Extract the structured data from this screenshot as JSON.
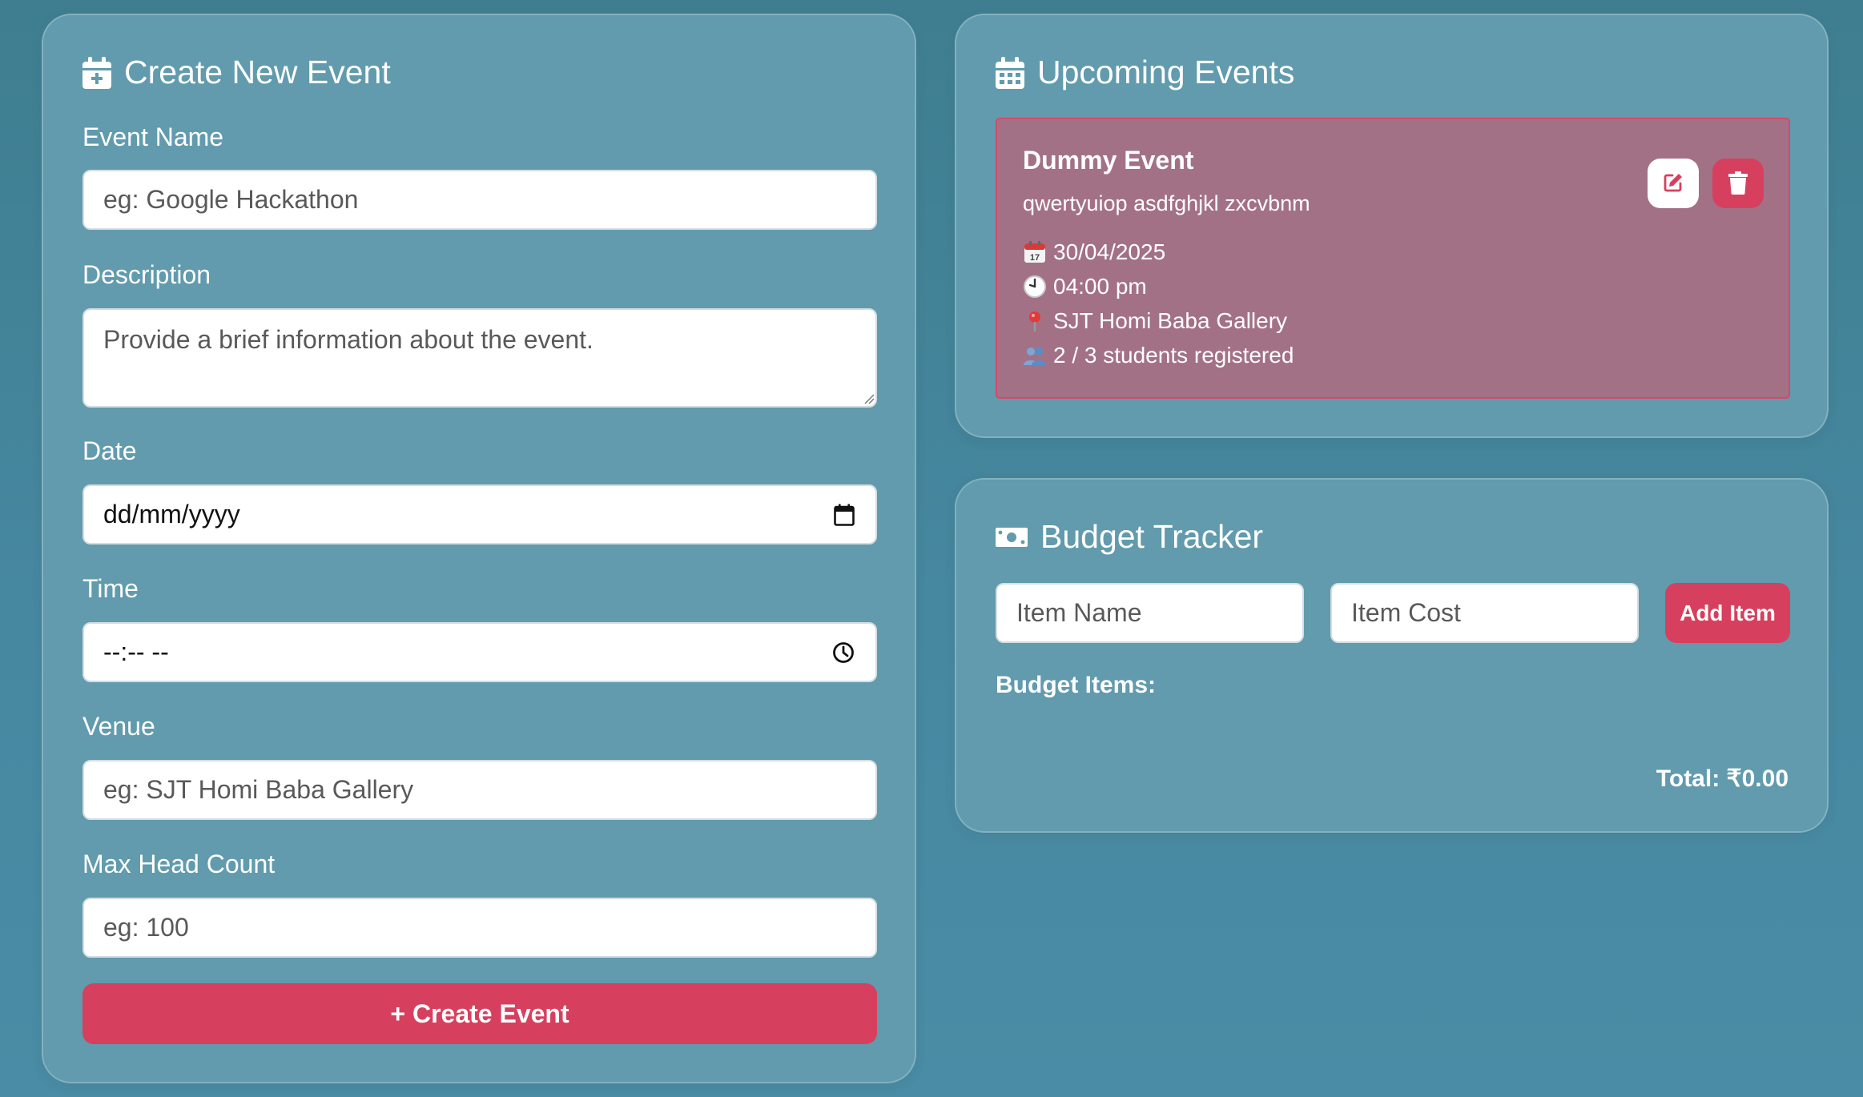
{
  "colors": {
    "accent": "#d6405e",
    "card_background": "#619bad",
    "event_background": "#a37186"
  },
  "create_event": {
    "title": "Create New Event",
    "icon": "calendar-plus-icon",
    "event_name": {
      "label": "Event Name",
      "placeholder": "eg: Google Hackathon",
      "value": ""
    },
    "description": {
      "label": "Description",
      "placeholder": "Provide a brief information about the event.",
      "value": ""
    },
    "date": {
      "label": "Date",
      "display": "dd/mm/yyyy",
      "icon": "calendar-icon"
    },
    "time": {
      "label": "Time",
      "display": "--:-- --",
      "icon": "clock-icon"
    },
    "venue": {
      "label": "Venue",
      "placeholder": "eg: SJT Homi Baba Gallery",
      "value": ""
    },
    "max_head_count": {
      "label": "Max Head Count",
      "placeholder": "eg: 100",
      "value": ""
    },
    "submit_label": "+ Create Event"
  },
  "upcoming_events": {
    "title": "Upcoming Events",
    "icon": "calendar-days-icon",
    "events": [
      {
        "name": "Dummy Event",
        "description": "qwertyuiop asdfghjkl zxcvbnm",
        "date": "30/04/2025",
        "time": "04:00 pm",
        "venue": "SJT Homi Baba Gallery",
        "registration": "2 / 3 students registered",
        "actions": [
          "edit-icon",
          "trash-icon"
        ]
      }
    ]
  },
  "budget_tracker": {
    "title": "Budget Tracker",
    "icon": "money-bill-icon",
    "item_name_placeholder": "Item Name",
    "item_cost_placeholder": "Item Cost",
    "add_label": "Add Item",
    "items_label": "Budget Items:",
    "items": [],
    "total": "Total: ₹0.00"
  }
}
